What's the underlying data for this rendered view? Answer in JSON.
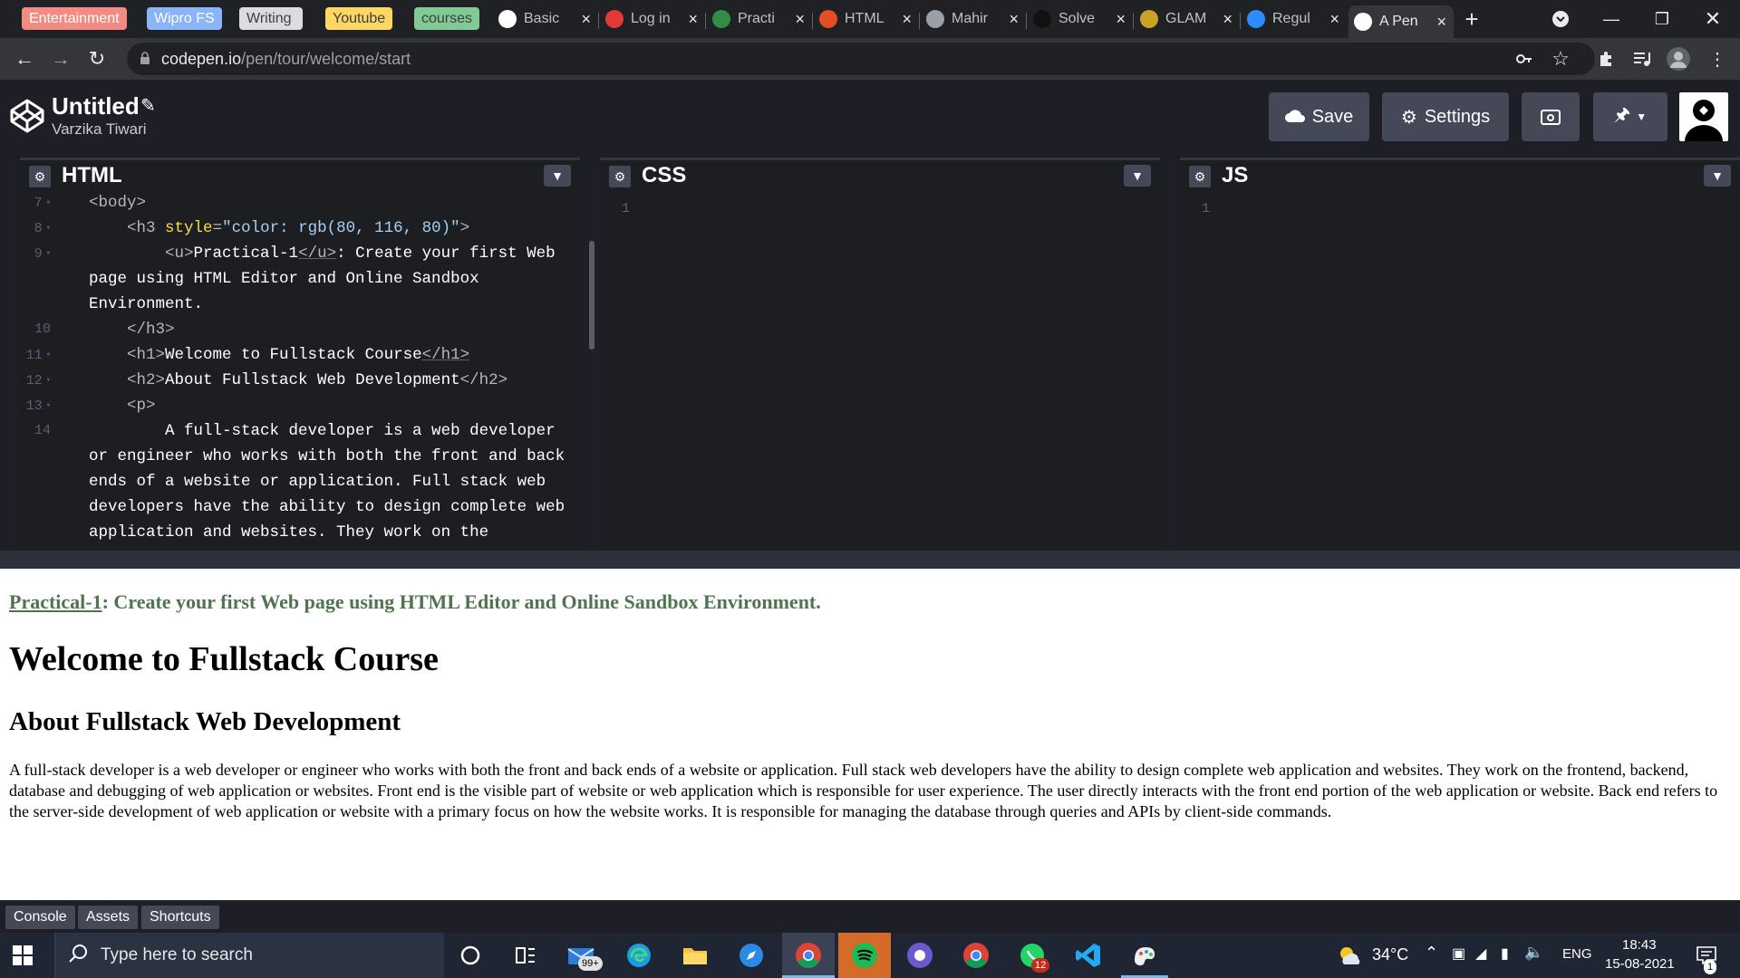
{
  "browser": {
    "bookmarks": [
      {
        "label": "Entertainment",
        "bg": "#f28b82",
        "fg": "#ffffff"
      },
      {
        "label": "Wipro FS",
        "bg": "#8ab4f8",
        "fg": "#ffffff"
      },
      {
        "label": "Writing",
        "bg": "#dadce0",
        "fg": "#3c4043"
      },
      {
        "label": "Youtube",
        "bg": "#fdd663",
        "fg": "#3c4043"
      },
      {
        "label": "courses",
        "bg": "#81c995",
        "fg": "#3c4043"
      }
    ],
    "tabs": [
      {
        "label": "Basic",
        "icon": "github-icon",
        "color": "#ffffff"
      },
      {
        "label": "Log in",
        "icon": "opera-icon",
        "color": "#e53935"
      },
      {
        "label": "Practi",
        "icon": "geeksforgeeks-icon",
        "color": "#2f8d46"
      },
      {
        "label": "HTML",
        "icon": "html-icon",
        "color": "#e44d26"
      },
      {
        "label": "Mahir",
        "icon": "globe-icon",
        "color": "#9aa0a6"
      },
      {
        "label": "Solve",
        "icon": "hackerrank-icon",
        "color": "#111111"
      },
      {
        "label": "GLAM",
        "icon": "glam-icon",
        "color": "#c9a227"
      },
      {
        "label": "Regul",
        "icon": "zoom-icon",
        "color": "#2d8cff"
      },
      {
        "label": "A Pen",
        "icon": "codepen-icon",
        "color": "#ffffff"
      }
    ],
    "url_host": "codepen.io",
    "url_path": "/pen/tour/welcome/start"
  },
  "codepen": {
    "title": "Untitled",
    "author": "Varzika Tiwari",
    "buttons": {
      "save": "Save",
      "settings": "Settings"
    },
    "editors": {
      "html": "HTML",
      "css": "CSS",
      "js": "JS"
    },
    "empty_line": "1",
    "html_lines": [
      {
        "num": "7",
        "fold": true,
        "parts": [
          {
            "c": "tag",
            "t": "<body>"
          }
        ]
      },
      {
        "num": "8",
        "fold": true,
        "parts": [
          {
            "c": "",
            "t": "    "
          },
          {
            "c": "tag",
            "t": "<h3 "
          },
          {
            "c": "attr",
            "t": "style"
          },
          {
            "c": "tag",
            "t": "="
          },
          {
            "c": "str",
            "t": "\"color: rgb(80, 116, 80)\""
          },
          {
            "c": "tag",
            "t": ">"
          }
        ]
      },
      {
        "num": "9",
        "fold": true,
        "parts": [
          {
            "c": "",
            "t": "        "
          },
          {
            "c": "tag",
            "t": "<u>"
          },
          {
            "c": "",
            "t": "Practical-1"
          },
          {
            "c": "tag utag",
            "t": "</u>"
          },
          {
            "c": "",
            "t": ": Create your first Web"
          }
        ]
      },
      {
        "num": "",
        "fold": false,
        "parts": [
          {
            "c": "",
            "t": "page using HTML Editor and Online Sandbox"
          }
        ]
      },
      {
        "num": "",
        "fold": false,
        "parts": [
          {
            "c": "",
            "t": "Environment."
          }
        ]
      },
      {
        "num": "10",
        "fold": false,
        "parts": [
          {
            "c": "",
            "t": "    "
          },
          {
            "c": "tag",
            "t": "</h3>"
          }
        ]
      },
      {
        "num": "11",
        "fold": true,
        "parts": [
          {
            "c": "",
            "t": "    "
          },
          {
            "c": "tag",
            "t": "<h1>"
          },
          {
            "c": "",
            "t": "Welcome to Fullstack Course"
          },
          {
            "c": "tag utag",
            "t": "</h1>"
          }
        ]
      },
      {
        "num": "12",
        "fold": true,
        "parts": [
          {
            "c": "",
            "t": "    "
          },
          {
            "c": "tag",
            "t": "<h2>"
          },
          {
            "c": "",
            "t": "About Fullstack Web Development"
          },
          {
            "c": "tag",
            "t": "</h2>"
          }
        ]
      },
      {
        "num": "13",
        "fold": true,
        "parts": [
          {
            "c": "",
            "t": "    "
          },
          {
            "c": "tag",
            "t": "<p>"
          }
        ]
      },
      {
        "num": "14",
        "fold": false,
        "parts": [
          {
            "c": "",
            "t": "        A full-stack developer is a web developer"
          }
        ]
      },
      {
        "num": "",
        "fold": false,
        "parts": [
          {
            "c": "",
            "t": "or engineer who works with both the front and back"
          }
        ]
      },
      {
        "num": "",
        "fold": false,
        "parts": [
          {
            "c": "",
            "t": "ends of a website or application. Full stack web"
          }
        ]
      },
      {
        "num": "",
        "fold": false,
        "parts": [
          {
            "c": "",
            "t": "developers have the ability to design complete web"
          }
        ]
      },
      {
        "num": "",
        "fold": false,
        "parts": [
          {
            "c": "",
            "t": "application and websites. They work on the"
          }
        ]
      }
    ],
    "footer": {
      "console": "Console",
      "assets": "Assets",
      "shortcuts": "Shortcuts"
    }
  },
  "preview": {
    "h3_link": "Practical-1",
    "h3_rest": ": Create your first Web page using HTML Editor and Online Sandbox Environment.",
    "h1": "Welcome to Fullstack Course",
    "h2": "About Fullstack Web Development",
    "paragraph": "A full-stack developer is a web developer or engineer who works with both the front and back ends of a website or application. Full stack web developers have the ability to design complete web application and websites. They work on the frontend, backend, database and debugging of web application or websites. Front end is the visible part of website or web application which is responsible for user experience. The user directly interacts with the front end portion of the web application or website. Back end refers to the server-side development of web application or website with a primary focus on how the website works. It is responsible for managing the database through queries and APIs by client-side commands.",
    "h3_color": "#507450"
  },
  "taskbar": {
    "search_placeholder": "Type here to search",
    "mail_badge": "99+",
    "whatsapp_badge": "12",
    "temperature": "34°C",
    "language": "ENG",
    "time": "18:43",
    "date": "15-08-2021",
    "notification_badge": "1"
  }
}
